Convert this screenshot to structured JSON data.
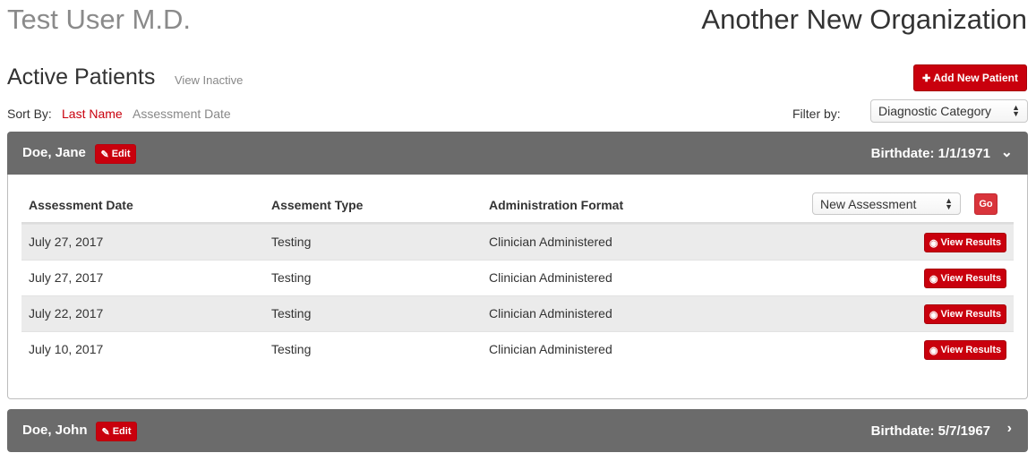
{
  "header": {
    "user_name": "Test User M.D.",
    "org_name": "Another New Organization"
  },
  "patients_section": {
    "title": "Active Patients",
    "view_inactive_label": "View Inactive",
    "add_patient_label": "Add New Patient",
    "sort_label": "Sort By:",
    "sort_options": [
      "Last Name",
      "Assessment Date"
    ],
    "sort_active": "Last Name",
    "filter_label": "Filter by:",
    "filter_value": "Diagnostic Category"
  },
  "patients": [
    {
      "name": "Doe, Jane",
      "edit_label": "Edit",
      "birthdate": "Birthdate: 1/1/1971",
      "expanded": true,
      "columns": [
        "Assessment Date",
        "Assement Type",
        "Administration Format"
      ],
      "new_assessment_value": "New Assessment",
      "go_label": "Go",
      "assessments": [
        {
          "date": "July 27, 2017",
          "type": "Testing",
          "format": "Clinician Administered",
          "action": "View Results"
        },
        {
          "date": "July 27, 2017",
          "type": "Testing",
          "format": "Clinician Administered",
          "action": "View Results"
        },
        {
          "date": "July 22, 2017",
          "type": "Testing",
          "format": "Clinician Administered",
          "action": "View Results"
        },
        {
          "date": "July 10, 2017",
          "type": "Testing",
          "format": "Clinician Administered",
          "action": "View Results"
        }
      ]
    },
    {
      "name": "Doe, John",
      "edit_label": "Edit",
      "birthdate": "Birthdate: 5/7/1967",
      "expanded": false
    }
  ],
  "icons": {
    "add": "plus-icon",
    "edit": "edit-icon",
    "view": "eye-icon",
    "expand": "chevron-down-icon",
    "collapse": "chevron-right-icon",
    "select": "select-arrows-icon"
  },
  "colors": {
    "accent": "#c9000d",
    "header_bar": "#6b6b6b",
    "row_shade": "#ebebeb",
    "muted_text": "#888888"
  }
}
